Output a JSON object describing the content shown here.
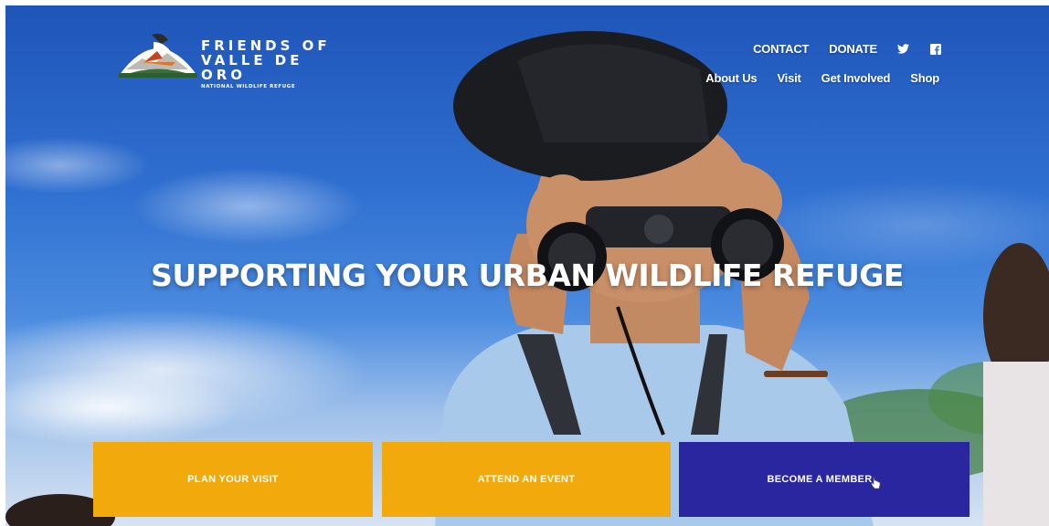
{
  "colors": {
    "cta_primary": "#f2a90c",
    "cta_secondary": "#2a26a0",
    "text": "#ffffff"
  },
  "logo": {
    "line1": "FRIENDS OF",
    "line2": "VALLE DE ORO",
    "subtitle": "NATIONAL WILDLIFE REFUGE"
  },
  "utility_nav": [
    {
      "label": "CONTACT"
    },
    {
      "label": "DONATE"
    }
  ],
  "social_icons": [
    "twitter-icon",
    "facebook-icon"
  ],
  "main_nav": [
    {
      "label": "About Us"
    },
    {
      "label": "Visit"
    },
    {
      "label": "Get Involved"
    },
    {
      "label": "Shop"
    }
  ],
  "hero": {
    "headline": "SUPPORTING YOUR URBAN WILDLIFE REFUGE"
  },
  "cta": [
    {
      "label": "PLAN YOUR VISIT"
    },
    {
      "label": "ATTEND AN EVENT"
    },
    {
      "label": "BECOME A MEMBER"
    }
  ]
}
